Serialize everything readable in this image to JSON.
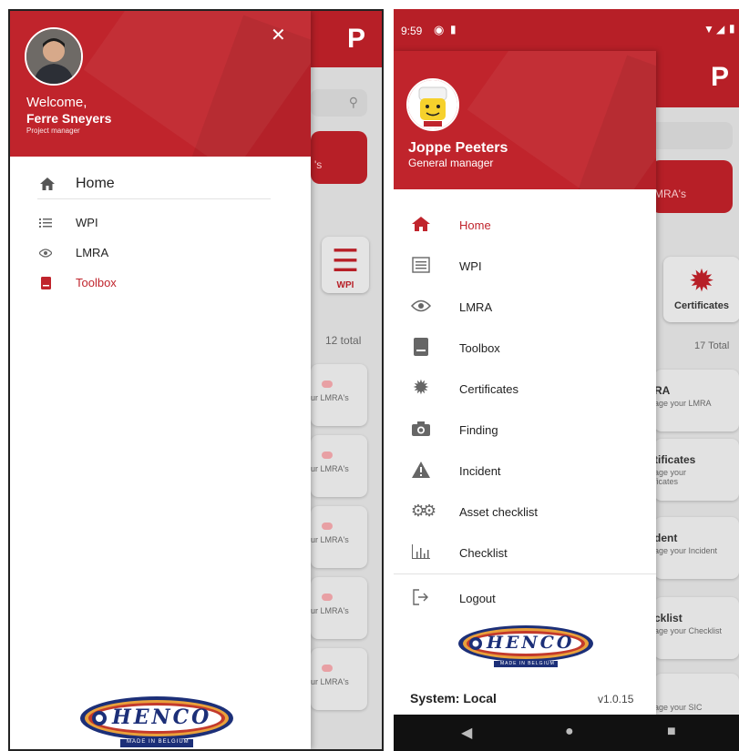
{
  "left": {
    "drawer": {
      "welcome": "Welcome,",
      "user_name": "Ferre Sneyers",
      "user_role": "Project manager",
      "close_icon": "close-icon",
      "items": [
        {
          "label": "Home",
          "icon": "home-icon",
          "active": false
        },
        {
          "label": "WPI",
          "icon": "list-icon",
          "active": false
        },
        {
          "label": "LMRA",
          "icon": "eye-icon",
          "active": false
        },
        {
          "label": "Toolbox",
          "icon": "book-icon",
          "active": true
        }
      ],
      "logo_text": "HENCO",
      "logo_tagline": "MADE IN BELGIUM"
    },
    "background": {
      "logo": "P",
      "banner_text": "'s",
      "tile_label": "WPI",
      "count": "12 total",
      "card_sub": "ur LMRA's"
    }
  },
  "right": {
    "status_time": "9:59",
    "drawer": {
      "user_name": "Joppe Peeters",
      "user_role": "General manager",
      "items": [
        {
          "label": "Home",
          "icon": "home-icon",
          "active": true
        },
        {
          "label": "WPI",
          "icon": "list-icon",
          "active": false
        },
        {
          "label": "LMRA",
          "icon": "eye-icon",
          "active": false
        },
        {
          "label": "Toolbox",
          "icon": "book-icon",
          "active": false
        },
        {
          "label": "Certificates",
          "icon": "certificate-icon",
          "active": false
        },
        {
          "label": "Finding",
          "icon": "camera-icon",
          "active": false
        },
        {
          "label": "Incident",
          "icon": "warning-icon",
          "active": false
        },
        {
          "label": "Asset checklist",
          "icon": "cogs-icon",
          "active": false
        },
        {
          "label": "Checklist",
          "icon": "chart-icon",
          "active": false
        }
      ],
      "logout": "Logout",
      "logo_text": "HENCO",
      "logo_tagline": "MADE IN BELGIUM",
      "system": "System: Local",
      "version": "v1.0.15"
    },
    "background": {
      "logo": "P",
      "banner_text": "MRA's",
      "tile_label": "Certificates",
      "count": "17 Total",
      "cards": [
        {
          "title": "RA",
          "sub": "age your LMRA"
        },
        {
          "title": "tificates",
          "sub": "age your ficates"
        },
        {
          "title": "dent",
          "sub": "age your Incident"
        },
        {
          "title": "cklist",
          "sub": "age your Checklist"
        },
        {
          "title": "",
          "sub": "age your SIC"
        }
      ]
    }
  },
  "colors": {
    "brand_red": "#c0242c",
    "dark_red": "#b71f27"
  }
}
